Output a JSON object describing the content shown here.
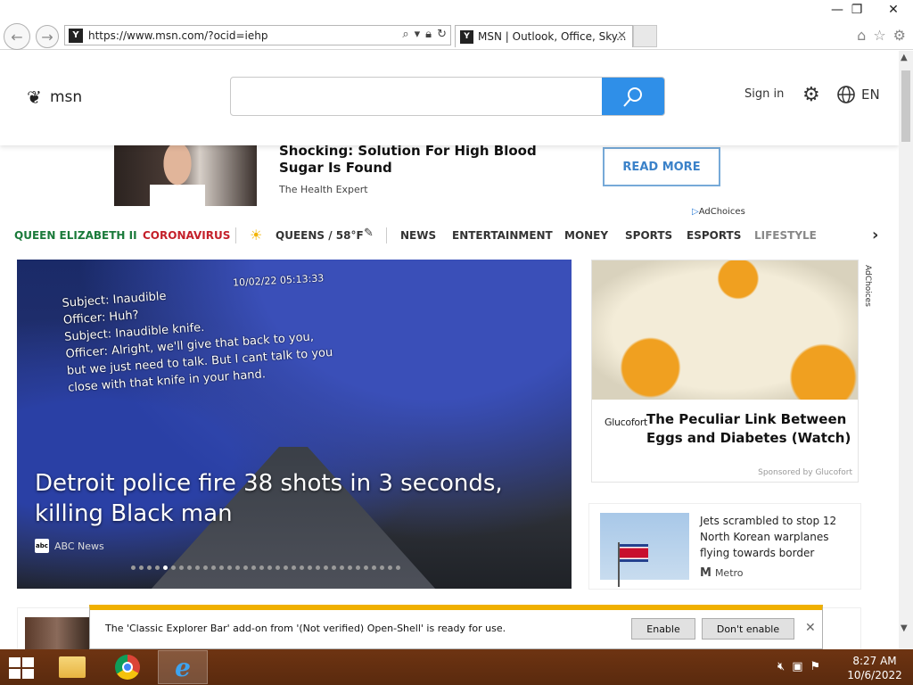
{
  "window": {
    "min": "—",
    "max": "❐",
    "close": "✕"
  },
  "nav": {
    "back": "←",
    "forward": "→"
  },
  "address": {
    "url": "https://www.msn.com/?ocid=iehp",
    "favicon": "Y"
  },
  "tab": {
    "title": "MSN | Outlook, Office, Sky...",
    "close": "✕"
  },
  "toolbar_icons": {
    "home": "⌂",
    "favorites": "☆",
    "settings": "⚙"
  },
  "header": {
    "logo": "msn",
    "signin": "Sign in",
    "lang": "EN",
    "logo_icon": "butterfly-icon"
  },
  "ad": {
    "headline": "Shocking: Solution For High Blood Sugar Is Found",
    "source": "The Health Expert",
    "cta": "READ MORE",
    "adchoices": "AdChoices"
  },
  "categories": {
    "queen": "QUEEN ELIZABETH II",
    "corona": "CORONAVIRUS",
    "weather": "QUEENS / 58°F",
    "news": "NEWS",
    "ent": "ENTERTAINMENT",
    "money": "MONEY",
    "sports": "SPORTS",
    "esports": "ESPORTS",
    "lifestyle": "LIFESTYLE",
    "colors": {
      "queen": "#1a7a3a",
      "corona": "#c4202a",
      "lifestyle": "#888888"
    }
  },
  "hero": {
    "timestamp": "10/02/22 05:13:33",
    "subtitle_lines": [
      "Subject: Inaudible",
      "Officer: Huh?",
      "Subject: Inaudible knife.",
      "Officer: Alright, we'll give that back to you,",
      "but we just need to talk. But I cant talk to you",
      "close with that knife in your hand."
    ],
    "headline": "Detroit police fire 38 shots in 3 seconds, killing Black man",
    "source": "ABC News",
    "source_icon": "abc"
  },
  "sidead": {
    "brand": "Glucofort",
    "headline": "The Peculiar Link Between Eggs and Diabetes (Watch)",
    "sponsored": "Sponsored by Glucofort",
    "adchoices": "AdChoices"
  },
  "card": {
    "headline": "Jets scrambled to stop 12 North Korean warplanes flying towards border",
    "source": "Metro",
    "source_icon": "M"
  },
  "notification": {
    "message": "The 'Classic Explorer Bar' add-on from '(Not verified) Open-Shell' is ready for use.",
    "enable": "Enable",
    "dont_enable": "Don't enable",
    "close": "✕"
  },
  "taskbar": {
    "time": "8:27 AM",
    "date": "10/6/2022"
  }
}
